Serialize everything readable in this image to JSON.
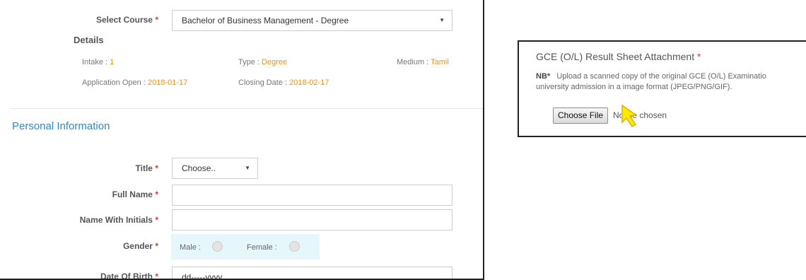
{
  "course": {
    "label": "Select Course",
    "required_mark": "*",
    "selected": "Bachelor of Business Management - Degree"
  },
  "details": {
    "heading": "Details",
    "intake_label": "Intake :",
    "intake_value": "1",
    "type_label": "Type :",
    "type_value": "Degree",
    "medium_label": "Medium :",
    "medium_value": "Tamil",
    "open_label": "Application Open :",
    "open_value": "2018-01-17",
    "closing_label": "Closing Date :",
    "closing_value": "2018-02-17"
  },
  "personal": {
    "heading": "Personal Information",
    "title_label": "Title",
    "title_selected": "Choose..",
    "full_name_label": "Full Name",
    "initials_label": "Name With Initials",
    "gender_label": "Gender",
    "male_label": "Male :",
    "female_label": "Female :",
    "dob_label": "Date Of Birth",
    "dob_placeholder": "dd-----yyyy",
    "required_mark": "*"
  },
  "attachment": {
    "title": "GCE (O/L) Result Sheet Attachment",
    "required_mark": "*",
    "nb_label": "NB*",
    "note_line1": "Upload a scanned copy of the original GCE (O/L) Examinatio",
    "note_line2": "university admission in a image format (JPEG/PNG/GIF).",
    "button_label": "Choose File",
    "file_status": "No file chosen"
  },
  "colors": {
    "accent_blue": "#2f88c9",
    "orange": "#f0921a",
    "required_red": "#e53935",
    "gender_bg": "#e6f7fb",
    "cursor_yellow": "#ffe800"
  }
}
